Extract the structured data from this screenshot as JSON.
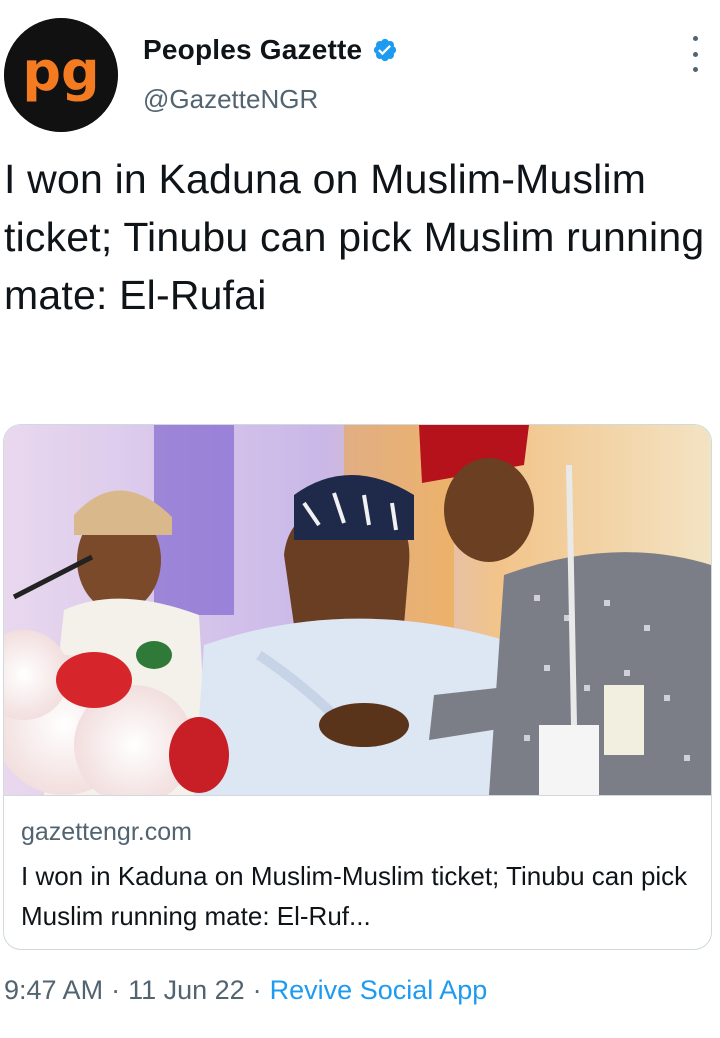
{
  "account": {
    "display_name": "Peoples Gazette",
    "handle": "@GazetteNGR",
    "avatar_text": "pg",
    "verified": true
  },
  "tweet": {
    "text": "I won in Kaduna on Muslim-Muslim ticket; Tinubu can pick Muslim running mate: El-Rufai"
  },
  "card": {
    "domain": "gazettengr.com",
    "title": "I won in Kaduna on Muslim-Muslim ticket; Tinubu can pick Muslim running mate: El-Ruf..."
  },
  "meta": {
    "time": "9:47 AM",
    "separator": "·",
    "date": "11 Jun 22",
    "source": "Revive Social App"
  },
  "colors": {
    "text_primary": "#0f1419",
    "text_secondary": "#536471",
    "link_blue": "#1d9bf0",
    "verified_blue": "#1d9bf0",
    "avatar_orange": "#f47b20",
    "border": "#cfd9de"
  },
  "icons": {
    "verified": "verified-badge-icon",
    "more": "more-vertical-icon"
  }
}
